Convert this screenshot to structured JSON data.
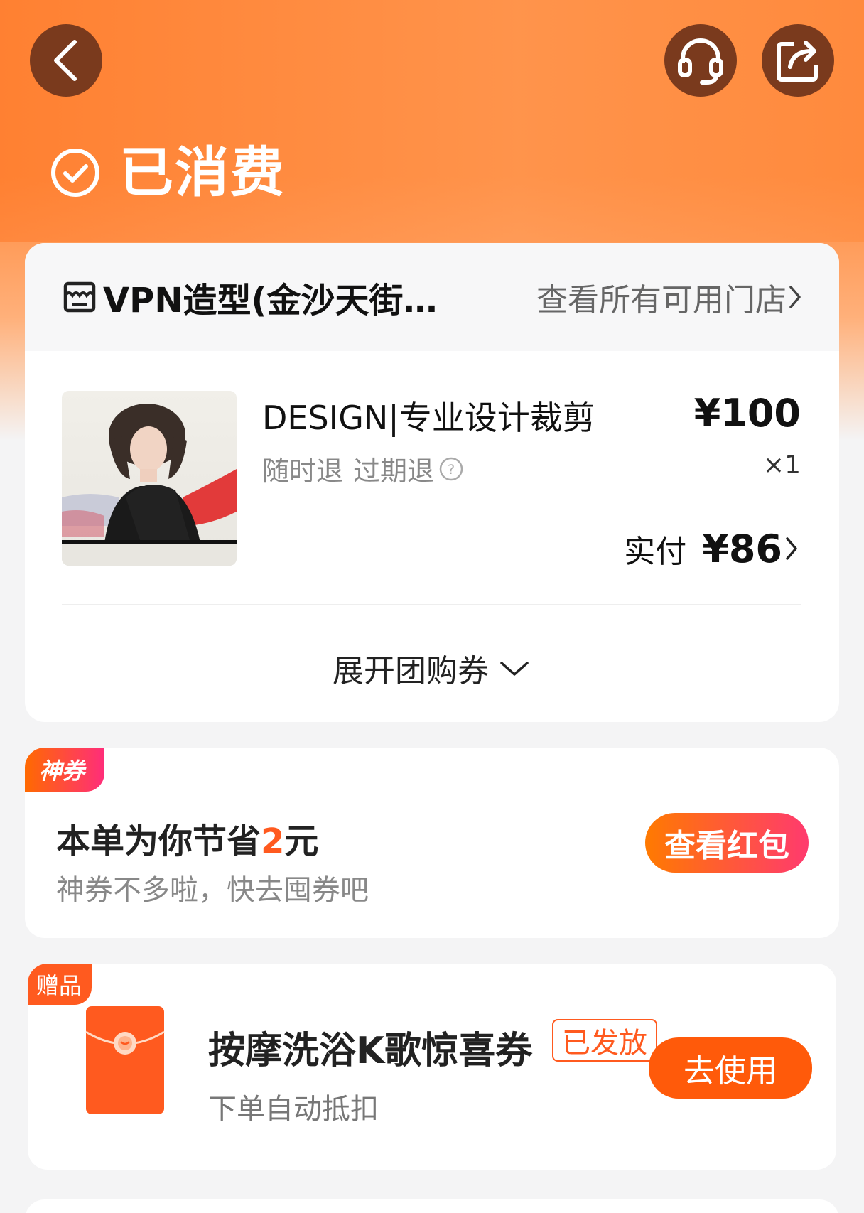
{
  "header": {
    "status_text": "已消费"
  },
  "store": {
    "name": "VPN造型(金沙天街…",
    "view_all_label": "查看所有可用门店"
  },
  "product": {
    "title": "DESIGN|专业设计裁剪",
    "tag_refund_anytime": "随时退",
    "tag_refund_expired": "过期退",
    "price": "¥100",
    "quantity": "×1",
    "paid_label": "实付",
    "paid_amount": "¥86"
  },
  "expand_label": "展开团购券",
  "coupon": {
    "tag": "神券",
    "main_prefix": "本单为你节省",
    "amount": "2",
    "main_suffix": "元",
    "subtitle": "神券不多啦，快去囤券吧",
    "button_label": "查看红包"
  },
  "gift": {
    "tag": "赠品",
    "title": "按摩洗浴K歌惊喜券",
    "badge": "已发放",
    "subtitle": "下单自动抵扣",
    "button_label": "去使用"
  },
  "colors": {
    "brand_orange": "#ff8a3d",
    "accent": "#ff5a1f",
    "icon_bg": "#7a3a1d"
  },
  "icons": [
    "back-icon",
    "headset-icon",
    "share-icon",
    "check-circle-icon",
    "store-icon",
    "chevron-right-icon",
    "question-icon",
    "chevron-down-icon",
    "red-envelope-icon"
  ]
}
